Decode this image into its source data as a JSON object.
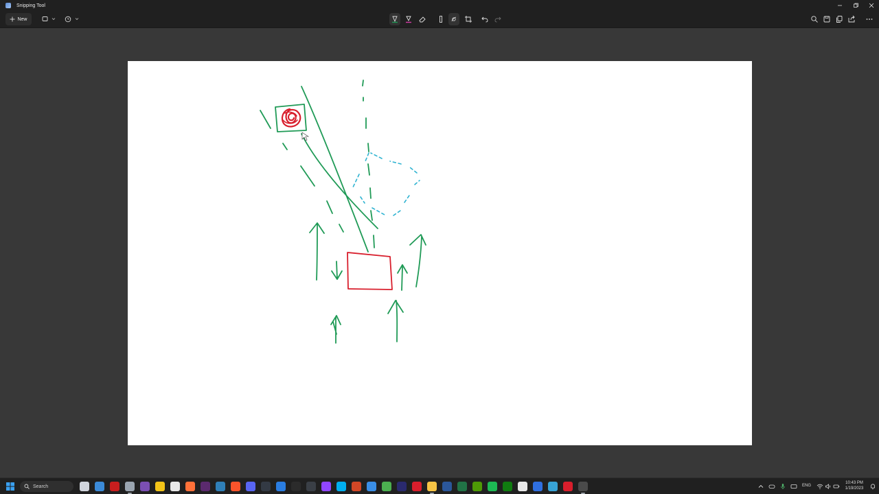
{
  "window": {
    "title": "Snipping Tool"
  },
  "toolbar": {
    "new_label": "New",
    "snip_mode_icon": "rectangle-snip-icon",
    "delay_icon": "clock-icon",
    "tools": [
      "ballpoint-pen-icon",
      "highlighter-icon",
      "eraser-icon",
      "ruler-icon",
      "touch-writing-icon",
      "crop-icon",
      "undo-icon",
      "redo-icon"
    ],
    "right_tools": [
      "zoom-icon",
      "save-icon",
      "copy-icon",
      "share-icon",
      "more-icon"
    ]
  },
  "canvas": {
    "background": "#ffffff",
    "ink_colors": {
      "green": "#1f9a56",
      "red": "#d81e2c",
      "cyan": "#2fb3d1"
    }
  },
  "taskbar": {
    "search_label": "Search",
    "apps": [
      "weather",
      "edge",
      "app-red",
      "vpn",
      "tor",
      "sticky-notes",
      "file",
      "firefox",
      "dictionary",
      "steam",
      "brave",
      "discord",
      "terminal",
      "app-blue",
      "obs",
      "obs-studio",
      "twitch",
      "skype",
      "powerpoint",
      "vscode",
      "snipping",
      "premiere",
      "acrobat",
      "explorer",
      "word",
      "excel",
      "terminal2",
      "spotify",
      "xbox",
      "notion",
      "todo",
      "notepad",
      "app-red2",
      "snipping-tool"
    ],
    "language": "ENG",
    "time": "10:43 PM",
    "date": "1/19/2023"
  }
}
